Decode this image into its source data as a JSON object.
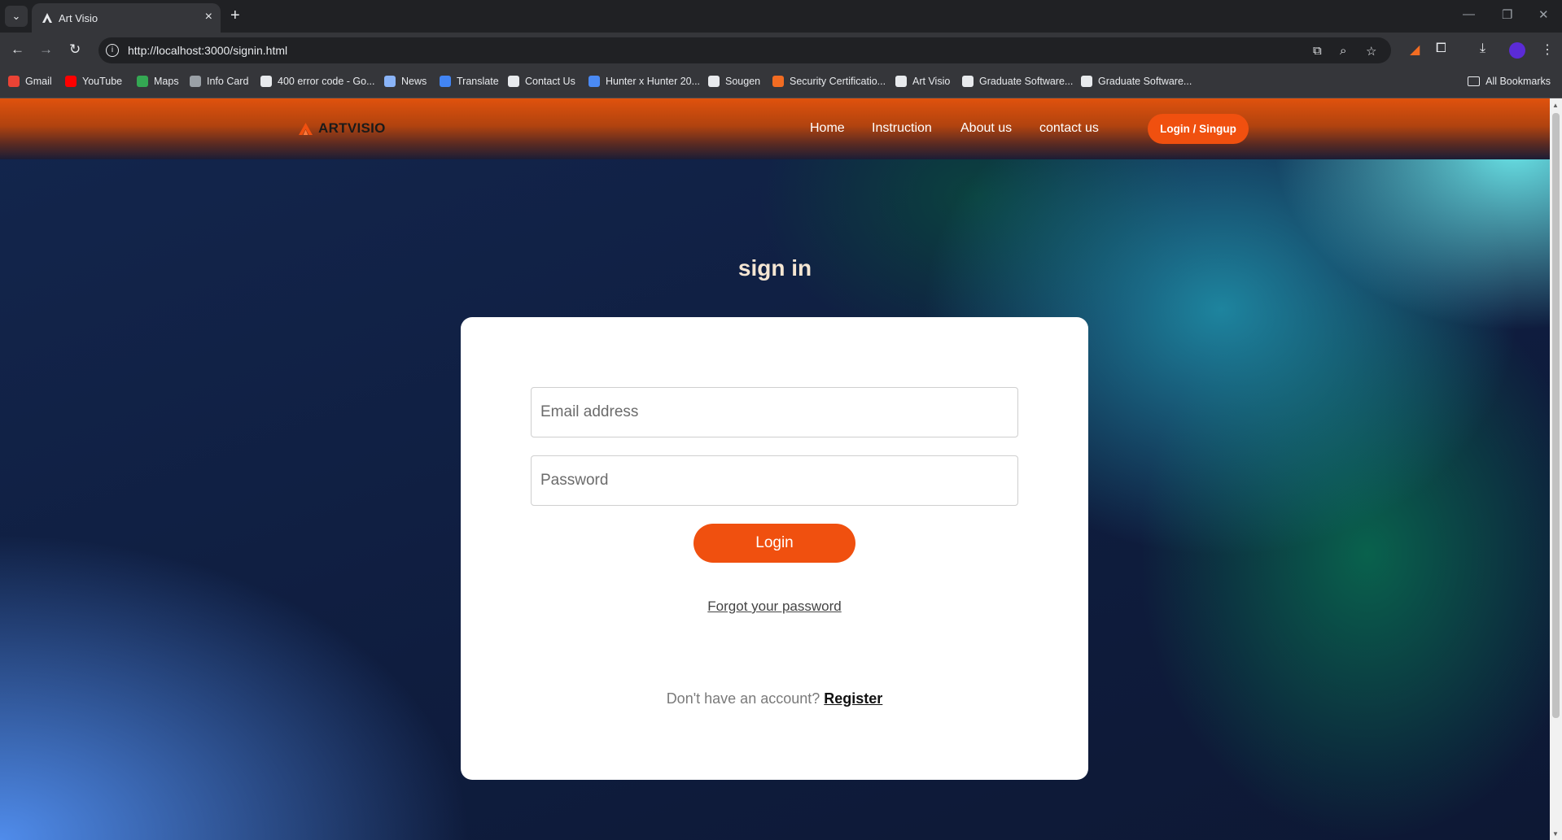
{
  "browser": {
    "tab_title": "Art Visio",
    "url": "http://localhost:3000/signin.html",
    "bookmarks": [
      {
        "label": "Gmail",
        "icon": "gmail-icon",
        "color": "#ea4335"
      },
      {
        "label": "YouTube",
        "icon": "youtube-icon",
        "color": "#ff0000"
      },
      {
        "label": "Maps",
        "icon": "maps-icon",
        "color": "#34a853"
      },
      {
        "label": "Info Card",
        "icon": "globe-icon",
        "color": "#9aa0a6"
      },
      {
        "label": "400 error code - Go...",
        "icon": "google-icon",
        "color": "#e8eaed"
      },
      {
        "label": "News",
        "icon": "news-icon",
        "color": "#8ab4f8"
      },
      {
        "label": "Translate",
        "icon": "translate-icon",
        "color": "#4285f4"
      },
      {
        "label": "Contact Us",
        "icon": "cs-icon",
        "color": "#e8eaed"
      },
      {
        "label": "Hunter x Hunter 20...",
        "icon": "play-icon",
        "color": "#4a8af4"
      },
      {
        "label": "Sougen",
        "icon": "loading-icon",
        "color": "#e8eaed"
      },
      {
        "label": "Security Certificatio...",
        "icon": "security-icon",
        "color": "#f26c22"
      },
      {
        "label": "Art Visio",
        "icon": "artvisio-icon",
        "color": "#e8eaed"
      },
      {
        "label": "Graduate Software...",
        "icon": "graduate-icon",
        "color": "#e8eaed"
      },
      {
        "label": "Graduate Software...",
        "icon": "graduate-icon",
        "color": "#e8eaed"
      }
    ],
    "all_bookmarks": "All Bookmarks"
  },
  "site": {
    "brand": "ARTVISIO",
    "nav": [
      "Home",
      "Instruction",
      "About us",
      "contact us"
    ],
    "cta": "Login / Singup",
    "accent": "#f0500f"
  },
  "signin": {
    "heading": "sign in",
    "email_placeholder": "Email address",
    "password_placeholder": "Password",
    "login_label": "Login",
    "forgot_label": "Forgot your password",
    "no_account": "Don't have an account?",
    "register_label": "Register"
  }
}
